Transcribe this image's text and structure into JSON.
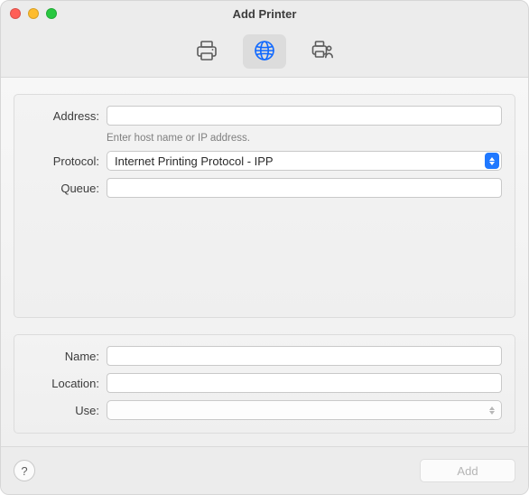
{
  "window": {
    "title": "Add Printer"
  },
  "tabs": {
    "default_name": "default-printer-tab",
    "ip_name": "ip-printer-tab",
    "windows_name": "windows-printer-tab",
    "selected": "ip"
  },
  "form": {
    "address_label": "Address:",
    "address_value": "",
    "address_hint": "Enter host name or IP address.",
    "protocol_label": "Protocol:",
    "protocol_value": "Internet Printing Protocol - IPP",
    "queue_label": "Queue:",
    "queue_value": ""
  },
  "details": {
    "name_label": "Name:",
    "name_value": "",
    "location_label": "Location:",
    "location_value": "",
    "use_label": "Use:",
    "use_value": ""
  },
  "footer": {
    "help_label": "?",
    "add_label": "Add",
    "add_enabled": false
  }
}
